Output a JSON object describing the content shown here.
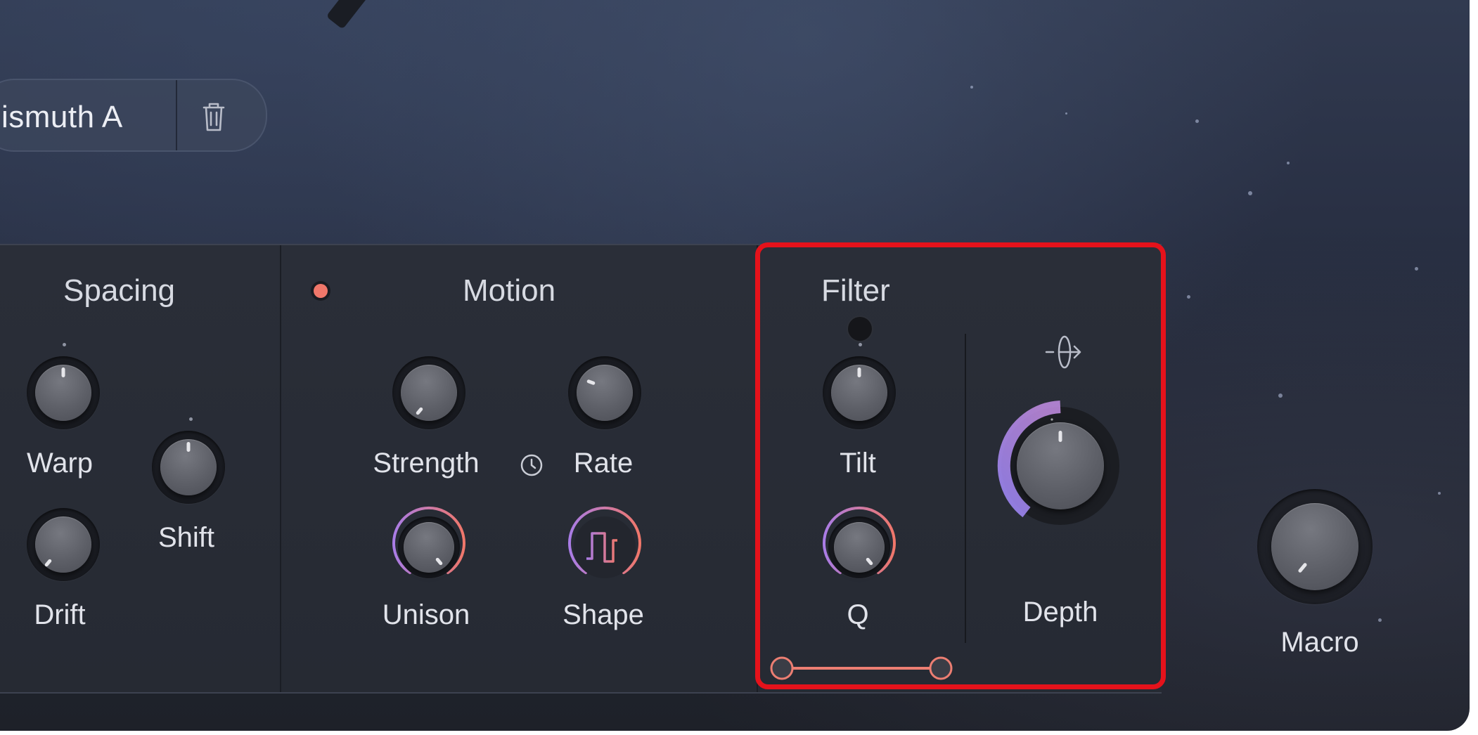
{
  "preset": {
    "name": "ismuth A",
    "delete_icon": "trash-icon"
  },
  "sections": {
    "spacing": {
      "title": "Spacing",
      "knobs": {
        "warp": "Warp",
        "shift": "Shift",
        "drift": "Drift"
      }
    },
    "motion": {
      "title": "Motion",
      "enabled_indicator_color": "#f0776a",
      "knobs": {
        "strength": "Strength",
        "rate": "Rate",
        "unison": "Unison",
        "shape": "Shape"
      },
      "rate_sync_icon": "clock-icon",
      "shape_icon": "square-wave-icon"
    },
    "filter": {
      "title": "Filter",
      "knobs": {
        "tilt": "Tilt",
        "q": "Q"
      },
      "depth_label": "Depth",
      "depth_mod_icon": "modulation-route-icon",
      "range_slider_color": "#ec7e72"
    }
  },
  "macro": {
    "label": "Macro"
  },
  "colors": {
    "highlight": "#e5121b",
    "accent_pink": "#f0776a",
    "accent_purple": "#a878e8"
  }
}
